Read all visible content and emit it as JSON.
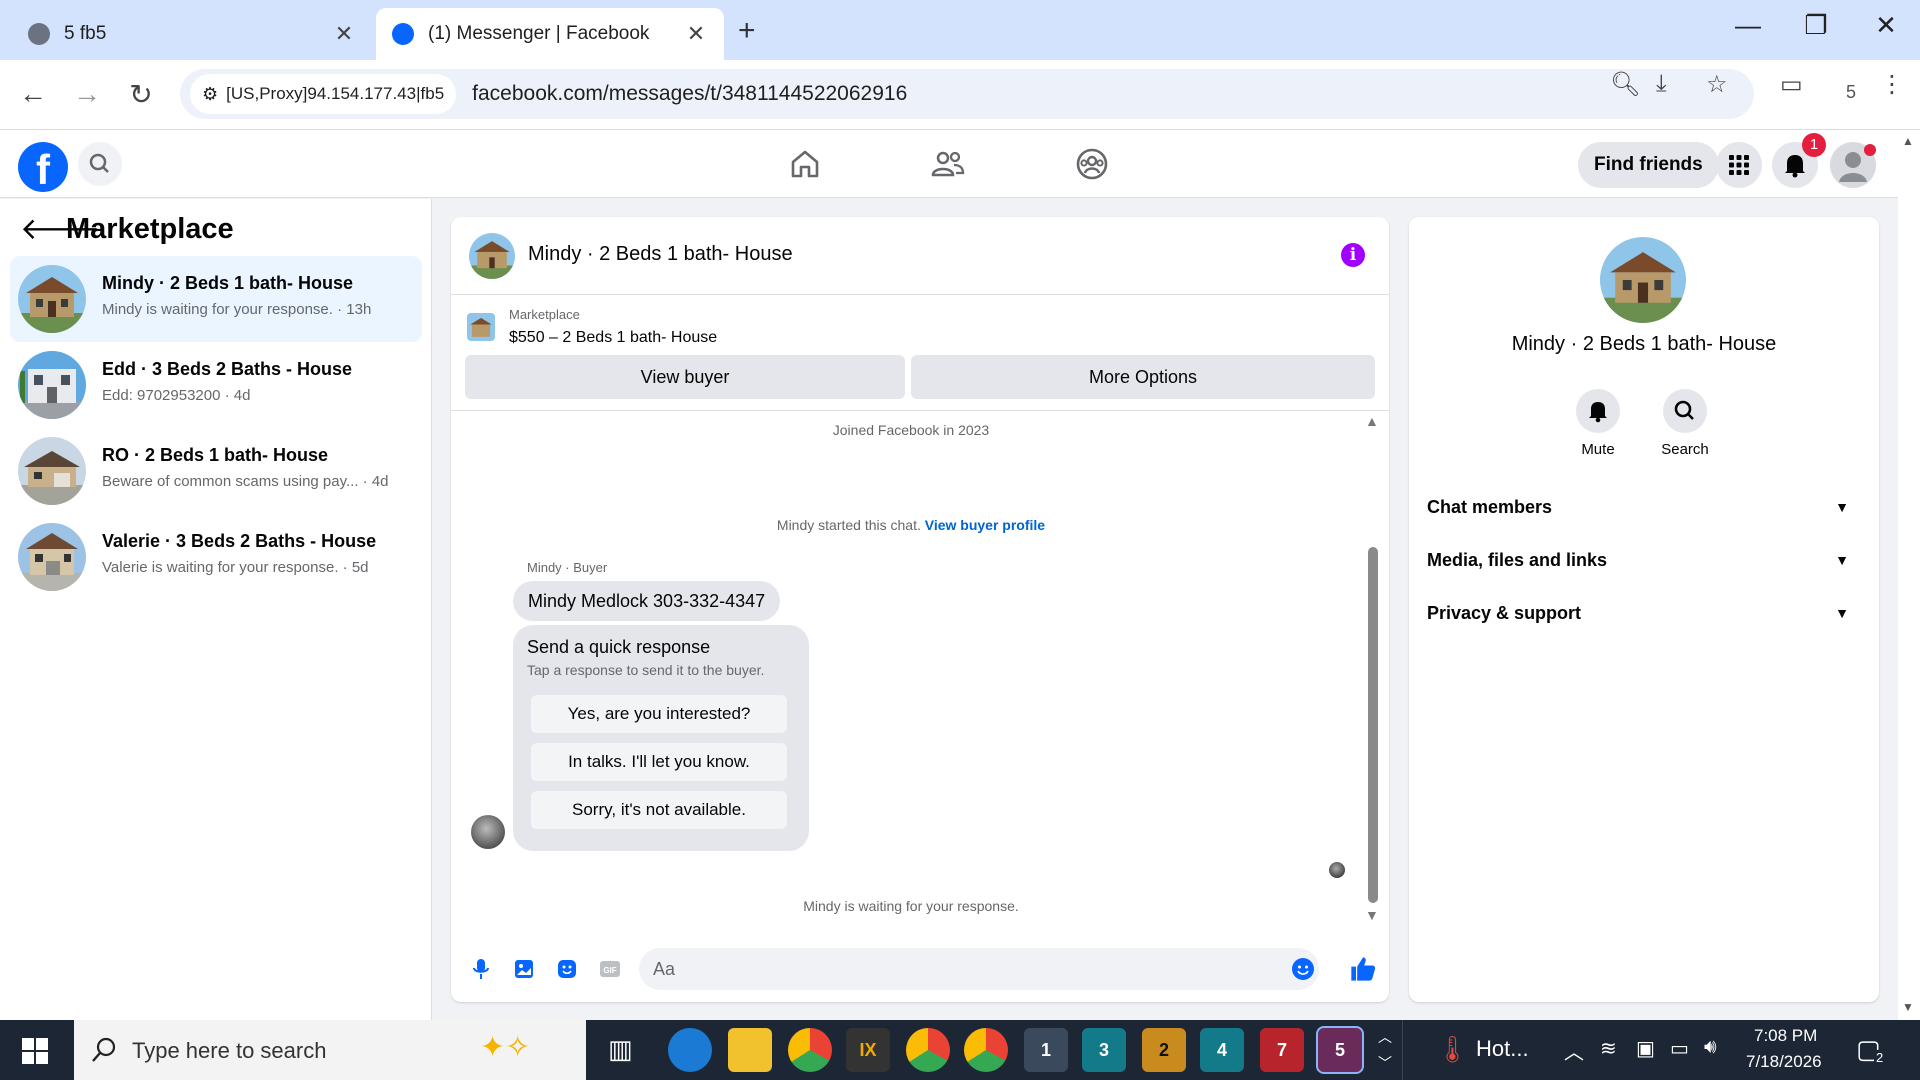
{
  "browser": {
    "tabs": [
      {
        "title": "5 fb5",
        "active": false
      },
      {
        "title": "(1) Messenger | Facebook",
        "active": true
      }
    ],
    "site_chip": "[US,Proxy]94.154.177.43|fb5",
    "url": "facebook.com/messages/t/3481144522062916",
    "profile_count": "5"
  },
  "fb_header": {
    "find_friends_label": "Find friends",
    "notification_count": "1"
  },
  "left_panel": {
    "title": "Marketplace",
    "conversations": [
      {
        "name": "Mindy · 2 Beds 1 bath- House",
        "subtitle": "Mindy is waiting for your response. · 13h",
        "selected": true
      },
      {
        "name": "Edd · 3 Beds 2 Baths - House",
        "subtitle": "Edd: 9702953200 · 4d",
        "selected": false
      },
      {
        "name": "RO · 2 Beds 1 bath- House",
        "subtitle": "Beware of common scams using pay... · 4d",
        "selected": false
      },
      {
        "name": "Valerie · 3 Beds 2 Baths - House",
        "subtitle": "Valerie is waiting for your response. · 5d",
        "selected": false
      }
    ]
  },
  "chat": {
    "title": "Mindy · 2 Beds 1 bath- House",
    "listing": {
      "category": "Marketplace",
      "title": "$550 – 2 Beds 1 bath- House"
    },
    "view_buyer_label": "View buyer",
    "more_options_label": "More Options",
    "joined": "Joined Facebook in 2023",
    "started_chat": "Mindy started this chat.",
    "view_buyer_profile": "View buyer profile",
    "sender_label": "Mindy · Buyer",
    "message": "Mindy Medlock 303-332-4347",
    "quick_response": {
      "title": "Send a quick response",
      "subtitle": "Tap a response to send it to the buyer.",
      "options": [
        "Yes, are you interested?",
        "In talks. I'll let you know.",
        "Sorry, it's not available."
      ]
    },
    "waiting_status": "Mindy is waiting for your response.",
    "composer_placeholder": "Aa"
  },
  "right_panel": {
    "name": "Mindy · 2 Beds 1 bath- House",
    "mute_label": "Mute",
    "search_label": "Search",
    "sections": [
      "Chat members",
      "Media, files and links",
      "Privacy & support"
    ]
  },
  "taskbar": {
    "search_placeholder": "Type here to search",
    "weather": "Hot...",
    "time": "7:08 PM",
    "date": "7/18/2026",
    "notification_count": "2",
    "app_badges": [
      "1",
      "3",
      "2",
      "4",
      "7",
      "5"
    ]
  },
  "colors": {
    "fb_blue": "#0866ff",
    "messenger_purple": "#a100ff",
    "selected_conv": "#ebf5ff",
    "taskbar": "#1c2634"
  }
}
